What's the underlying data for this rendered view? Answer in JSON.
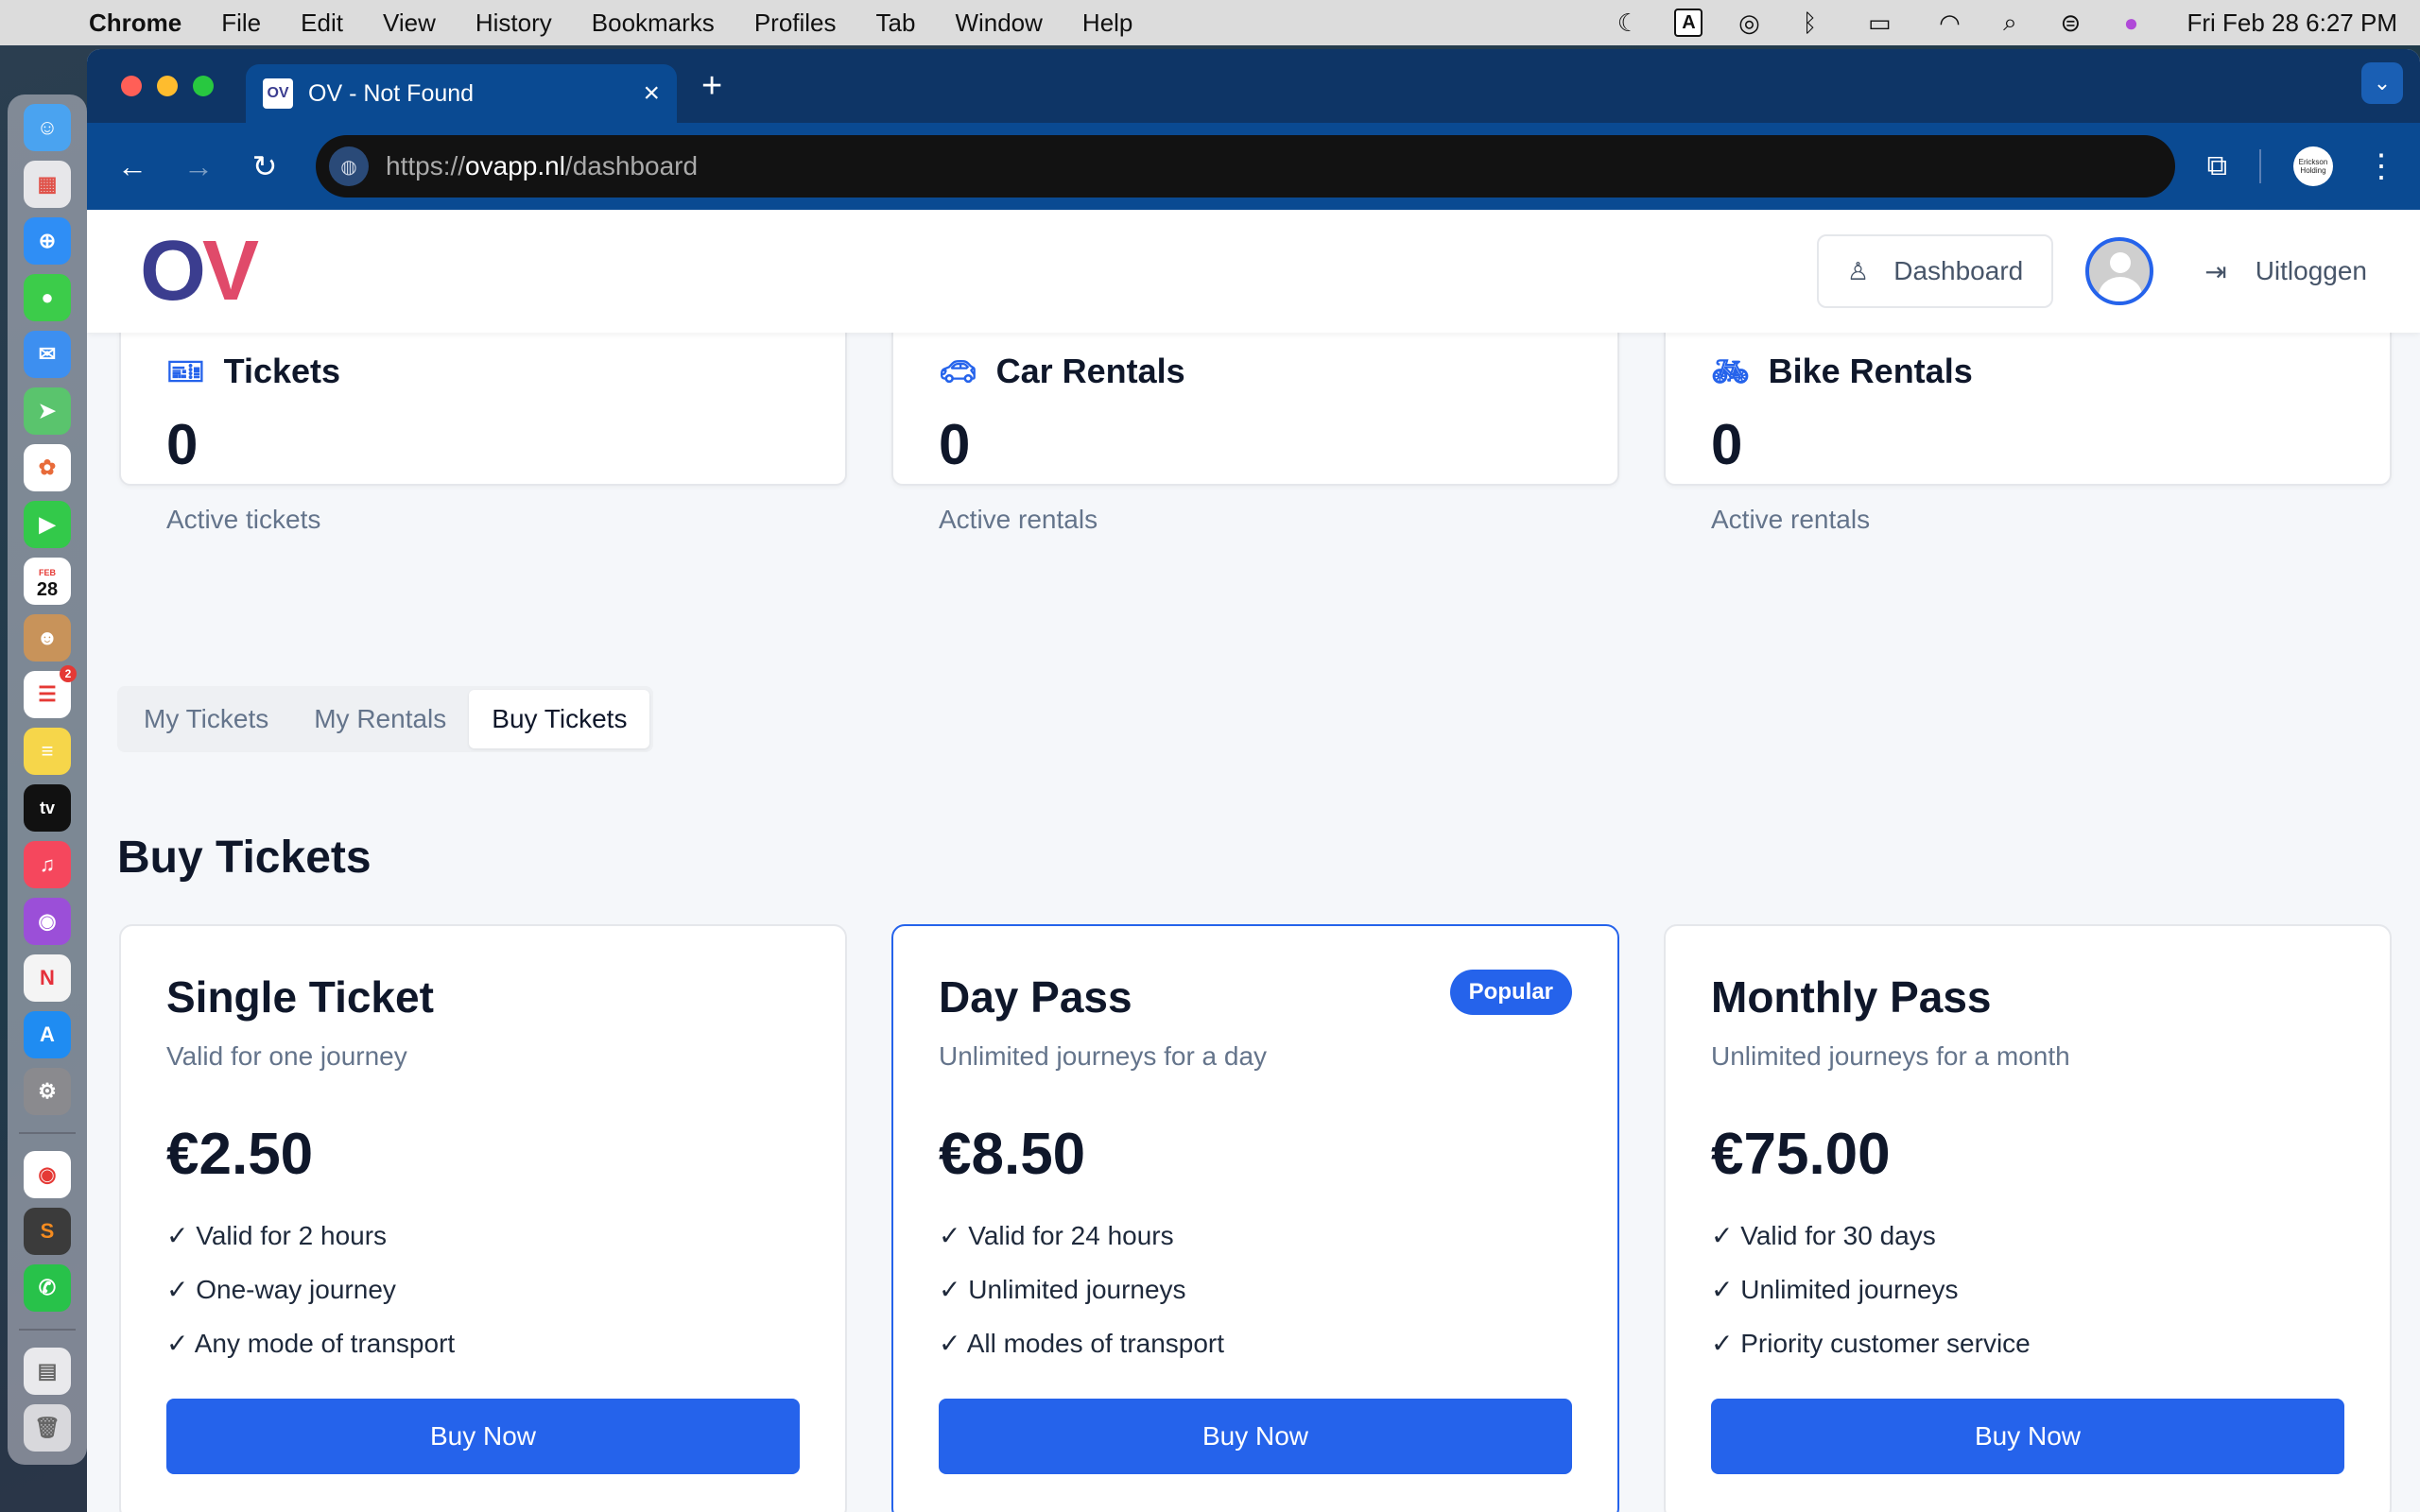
{
  "menubar": {
    "app": "Chrome",
    "items": [
      "File",
      "Edit",
      "View",
      "History",
      "Bookmarks",
      "Profiles",
      "Tab",
      "Window",
      "Help"
    ],
    "clock": "Fri Feb 28  6:27 PM",
    "input_source": "A"
  },
  "dock": {
    "calendar_month": "FEB",
    "calendar_day": "28",
    "reminders_badge": "2",
    "tv_label": "tv"
  },
  "browser": {
    "tab_title": "OV - Not Found",
    "favicon_text": "OV",
    "url_scheme": "https://",
    "url_host": "ovapp.nl",
    "url_path": "/dashboard",
    "profile_label": "Erickson Holding"
  },
  "header": {
    "logo_o": "O",
    "logo_v": "V",
    "dashboard_label": "Dashboard",
    "logout_label": "Uitloggen"
  },
  "stats": [
    {
      "title": "Tickets",
      "value": "0",
      "label": "Active tickets",
      "icon": "ticket-icon"
    },
    {
      "title": "Car Rentals",
      "value": "0",
      "label": "Active rentals",
      "icon": "car-icon"
    },
    {
      "title": "Bike Rentals",
      "value": "0",
      "label": "Active rentals",
      "icon": "bike-icon"
    }
  ],
  "tabs": [
    "My Tickets",
    "My Rentals",
    "Buy Tickets"
  ],
  "active_tab": "Buy Tickets",
  "section_title": "Buy Tickets",
  "products": [
    {
      "name": "Single Ticket",
      "desc": "Valid for one journey",
      "price": "€2.50",
      "features": [
        "✓ Valid for 2 hours",
        "✓ One-way journey",
        "✓ Any mode of transport"
      ],
      "button": "Buy Now"
    },
    {
      "name": "Day Pass",
      "desc": "Unlimited journeys for a day",
      "price": "€8.50",
      "badge": "Popular",
      "features": [
        "✓ Valid for 24 hours",
        "✓ Unlimited journeys",
        "✓ All modes of transport"
      ],
      "button": "Buy Now"
    },
    {
      "name": "Monthly Pass",
      "desc": "Unlimited journeys for a month",
      "price": "€75.00",
      "features": [
        "✓ Valid for 30 days",
        "✓ Unlimited journeys",
        "✓ Priority customer service"
      ],
      "button": "Buy Now"
    }
  ],
  "colors": {
    "accent": "#2563eb",
    "logo_o": "#3b3d8f",
    "logo_v": "#e04a6a",
    "chrome_frame": "#0a4a92"
  }
}
